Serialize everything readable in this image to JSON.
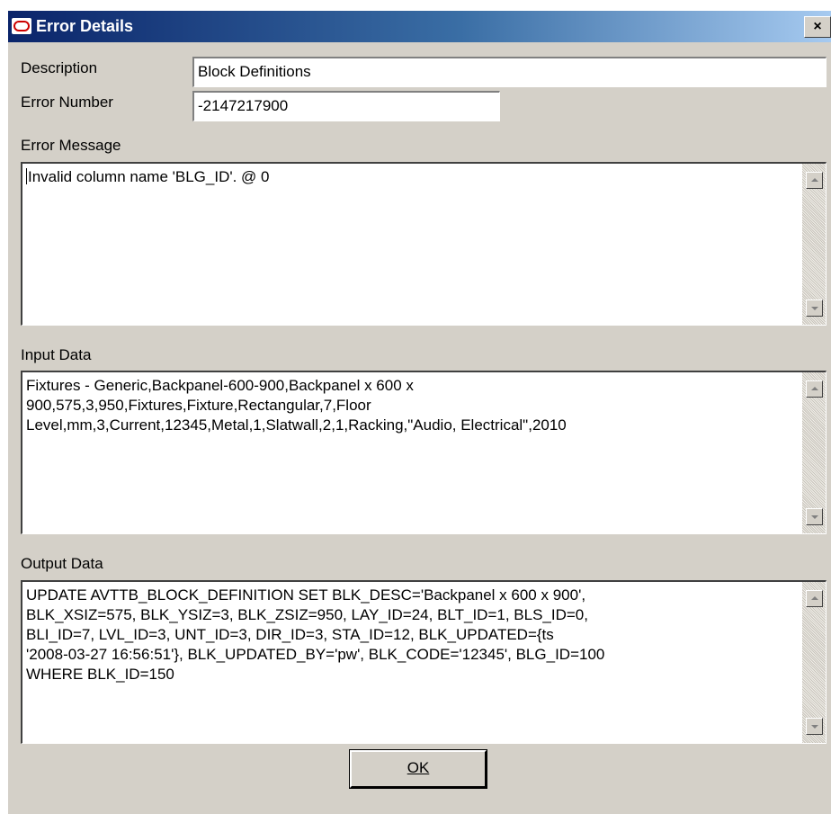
{
  "window": {
    "title": "Error Details",
    "close_label": "×"
  },
  "fields": {
    "description_label": "Description",
    "description_value": "Block Definitions",
    "error_number_label": "Error Number",
    "error_number_value": "-2147217900"
  },
  "error_message": {
    "label": "Error Message",
    "text": "Invalid column name 'BLG_ID'. @ 0"
  },
  "input_data": {
    "label": "Input Data",
    "text": "Fixtures - Generic,Backpanel-600-900,Backpanel x 600 x\n900,575,3,950,Fixtures,Fixture,Rectangular,7,Floor\nLevel,mm,3,Current,12345,Metal,1,Slatwall,2,1,Racking,\"Audio, Electrical\",2010"
  },
  "output_data": {
    "label": "Output Data",
    "text": "UPDATE AVTTB_BLOCK_DEFINITION SET BLK_DESC='Backpanel x 600 x 900',\nBLK_XSIZ=575, BLK_YSIZ=3, BLK_ZSIZ=950, LAY_ID=24, BLT_ID=1, BLS_ID=0,\nBLI_ID=7, LVL_ID=3, UNT_ID=3, DIR_ID=3, STA_ID=12, BLK_UPDATED={ts\n'2008-03-27 16:56:51'}, BLK_UPDATED_BY='pw', BLK_CODE='12345', BLG_ID=100\nWHERE BLK_ID=150"
  },
  "buttons": {
    "ok_label": "OK"
  },
  "icons": {
    "app_icon": "oracle-logo-icon",
    "close_icon": "close-icon",
    "scroll_up": "scroll-up-icon",
    "scroll_down": "scroll-down-icon"
  },
  "colors": {
    "title_gradient_start": "#0a246a",
    "title_gradient_end": "#a6caf0",
    "dialog_bg": "#d4d0c8"
  }
}
